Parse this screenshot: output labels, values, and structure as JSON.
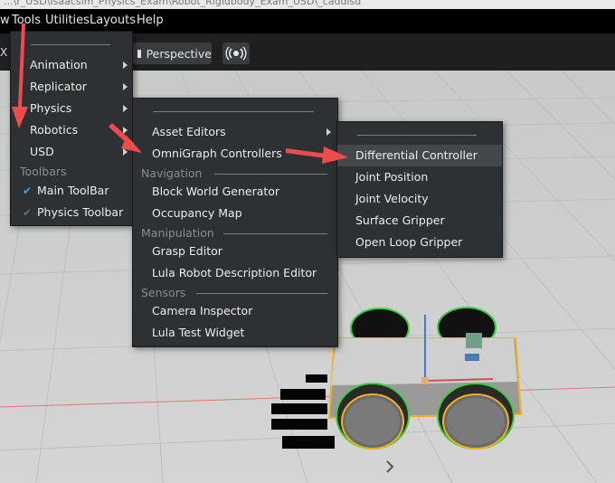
{
  "titlebar": {
    "text": "...\\r_USD\\Isaacsim_Physics_Exam\\Robot_Rigidbody_Exam_USD\\_caddisd"
  },
  "menubar": {
    "items": [
      "w",
      "Tools",
      "Utilities",
      "Layouts",
      "Help"
    ]
  },
  "toolbar": {
    "fragment": "X -",
    "perspective_label": "Perspective"
  },
  "menu1": {
    "items": [
      {
        "label": "Animation",
        "submenu": true
      },
      {
        "label": "Replicator",
        "submenu": true
      },
      {
        "label": "Physics",
        "submenu": true
      },
      {
        "label": "Robotics",
        "submenu": true
      },
      {
        "label": "USD",
        "submenu": true
      }
    ],
    "section": "Toolbars",
    "toolbar_items": [
      {
        "label": "Main ToolBar",
        "checked": true
      },
      {
        "label": "Physics Toolbar",
        "checked": false
      }
    ]
  },
  "menu2": {
    "items": [
      {
        "label": "Asset Editors",
        "submenu": true
      },
      {
        "label": "OmniGraph Controllers",
        "submenu": true
      }
    ],
    "sections": [
      {
        "title": "Navigation",
        "items": [
          "Block World Generator",
          "Occupancy Map"
        ]
      },
      {
        "title": "Manipulation",
        "items": [
          "Grasp Editor",
          "Lula Robot Description Editor"
        ]
      },
      {
        "title": "Sensors",
        "items": [
          "Camera Inspector",
          "Lula Test Widget"
        ]
      }
    ]
  },
  "menu3": {
    "items": [
      "Differential Controller",
      "Joint Position",
      "Joint Velocity",
      "Surface Gripper",
      "Open Loop Gripper"
    ],
    "highlighted": "Differential Controller"
  },
  "colors": {
    "arrow": "#ee4b4b",
    "check": "#3ea0e8",
    "robot_outline": "#f0b020",
    "wheel_stripe": "#3cd040",
    "menu_bg": "#2e3134"
  }
}
